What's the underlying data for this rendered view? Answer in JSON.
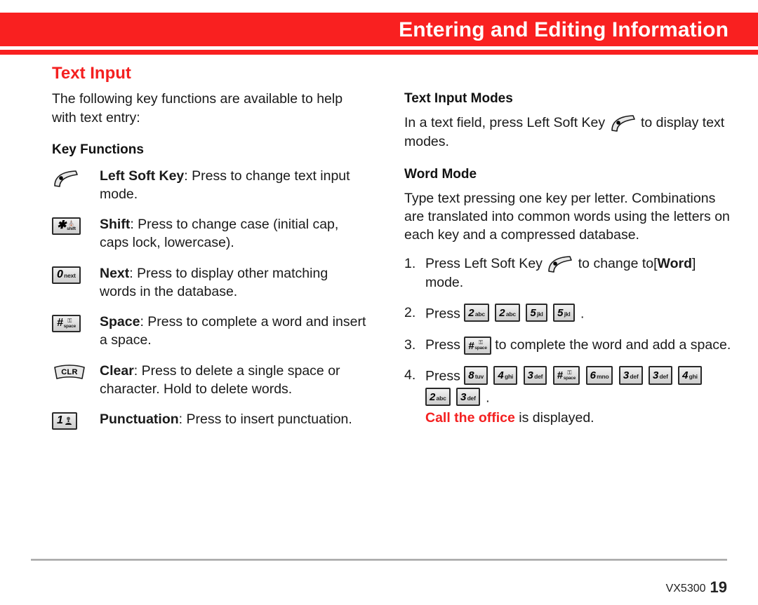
{
  "header": {
    "title": "Entering and Editing Information",
    "band_color": "#f92020"
  },
  "left_column": {
    "section_title": "Text Input",
    "intro": "The following key functions are available to help with text entry:",
    "key_functions_heading": "Key Functions",
    "items": [
      {
        "icon": "left-soft-key-icon",
        "icon_type": "softkey",
        "term": "Left Soft Key",
        "desc": ": Press to change text input mode."
      },
      {
        "icon": "star-shift-key-icon",
        "icon_type": "chip-shift",
        "key_digit": "✱",
        "key_glyph": "⛪",
        "key_label": "shift",
        "term": "Shift",
        "desc": ": Press to change case (initial cap, caps lock, lowercase)."
      },
      {
        "icon": "zero-next-key-icon",
        "icon_type": "chip",
        "key_digit": "0",
        "key_label": "next",
        "term": "Next",
        "desc": ": Press to display other matching words in the database."
      },
      {
        "icon": "pound-space-key-icon",
        "icon_type": "chip-space",
        "key_digit": "#",
        "key_glyph": "⚿",
        "key_label": "space",
        "term": "Space",
        "desc": ": Press to complete a word and insert a space."
      },
      {
        "icon": "clear-key-icon",
        "icon_type": "clr",
        "key_label": "CLR",
        "term": "Clear",
        "desc": ": Press to delete a single space or character. Hold to delete words."
      },
      {
        "icon": "one-punctuation-key-icon",
        "icon_type": "chip-voicemail",
        "key_digit": "1",
        "term": "Punctuation",
        "desc": ": Press to insert punctuation."
      }
    ]
  },
  "right_column": {
    "text_input_modes_heading": "Text Input Modes",
    "text_input_modes_before": "In a text field, press Left Soft Key",
    "text_input_modes_after": "to display text modes.",
    "word_mode_heading": "Word Mode",
    "word_mode_body": "Type text pressing one key per letter. Combinations are translated into common words using the letters on each key and a compressed database.",
    "steps": [
      {
        "num": "1.",
        "before": "Press Left Soft Key",
        "after_icon": "to change to",
        "bracket_open": "[",
        "bold_word": "Word",
        "bracket_close": "]",
        "tail": "mode."
      },
      {
        "num": "2.",
        "before": "Press",
        "keys": [
          {
            "digit": "2",
            "letters": "abc"
          },
          {
            "digit": "2",
            "letters": "abc"
          },
          {
            "digit": "5",
            "letters": "jkl"
          },
          {
            "digit": "5",
            "letters": "jkl"
          }
        ],
        "tail": "."
      },
      {
        "num": "3.",
        "before": "Press",
        "keys": [
          {
            "digit": "#",
            "letters": "space",
            "stacked": true,
            "glyph": "⚿"
          }
        ],
        "tail": "to complete the word and add a space."
      },
      {
        "num": "4.",
        "before": "Press",
        "keys": [
          {
            "digit": "8",
            "letters": "tuv"
          },
          {
            "digit": "4",
            "letters": "ghi"
          },
          {
            "digit": "3",
            "letters": "def"
          },
          {
            "digit": "#",
            "letters": "space",
            "stacked": true,
            "glyph": "⚿"
          },
          {
            "digit": "6",
            "letters": "mno"
          },
          {
            "digit": "3",
            "letters": "def"
          },
          {
            "digit": "3",
            "letters": "def"
          },
          {
            "digit": "4",
            "letters": "ghi"
          },
          {
            "digit": "2",
            "letters": "abc"
          },
          {
            "digit": "3",
            "letters": "def"
          }
        ],
        "tail": ".",
        "result_red": "Call the office",
        "result_rest": "is displayed."
      }
    ]
  },
  "footer": {
    "model": "VX5300",
    "page_number": "19"
  }
}
